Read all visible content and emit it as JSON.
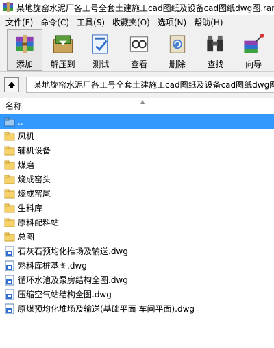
{
  "window": {
    "title": "某地旋窑水泥厂各工号全套土建施工cad图纸及设备cad图纸dwg图.rar"
  },
  "menu": [
    {
      "label": "文件(F)"
    },
    {
      "label": "命令(C)"
    },
    {
      "label": "工具(S)"
    },
    {
      "label": "收藏夹(O)"
    },
    {
      "label": "选项(N)"
    },
    {
      "label": "帮助(H)"
    }
  ],
  "toolbar": [
    {
      "label": "添加",
      "icon": "add-archive-icon"
    },
    {
      "label": "解压到",
      "icon": "extract-icon"
    },
    {
      "label": "测试",
      "icon": "test-icon"
    },
    {
      "label": "查看",
      "icon": "view-icon"
    },
    {
      "label": "删除",
      "icon": "delete-icon"
    },
    {
      "label": "查找",
      "icon": "find-icon"
    },
    {
      "label": "向导",
      "icon": "wizard-icon"
    }
  ],
  "path": {
    "text": "某地旋窑水泥厂各工号全套土建施工cad图纸及设备cad图纸dwg图.rar"
  },
  "list": {
    "column_name": "名称",
    "rows": [
      {
        "name": "..",
        "type": "parent"
      },
      {
        "name": "风机",
        "type": "folder"
      },
      {
        "name": "辅机设备",
        "type": "folder"
      },
      {
        "name": "煤磨",
        "type": "folder"
      },
      {
        "name": "烧成窑头",
        "type": "folder"
      },
      {
        "name": "烧成窑尾",
        "type": "folder"
      },
      {
        "name": "生料库",
        "type": "folder"
      },
      {
        "name": "原料配料站",
        "type": "folder"
      },
      {
        "name": "总图",
        "type": "folder"
      },
      {
        "name": "石灰石预均化推场及输送.dwg",
        "type": "dwg"
      },
      {
        "name": "熟料库桩基图.dwg",
        "type": "dwg"
      },
      {
        "name": "循环水池及泵房结构全图.dwg",
        "type": "dwg"
      },
      {
        "name": "压缩空气站结构全图.dwg",
        "type": "dwg"
      },
      {
        "name": "原煤预均化堆场及输送(基础平面  车间平面).dwg",
        "type": "dwg"
      }
    ]
  }
}
